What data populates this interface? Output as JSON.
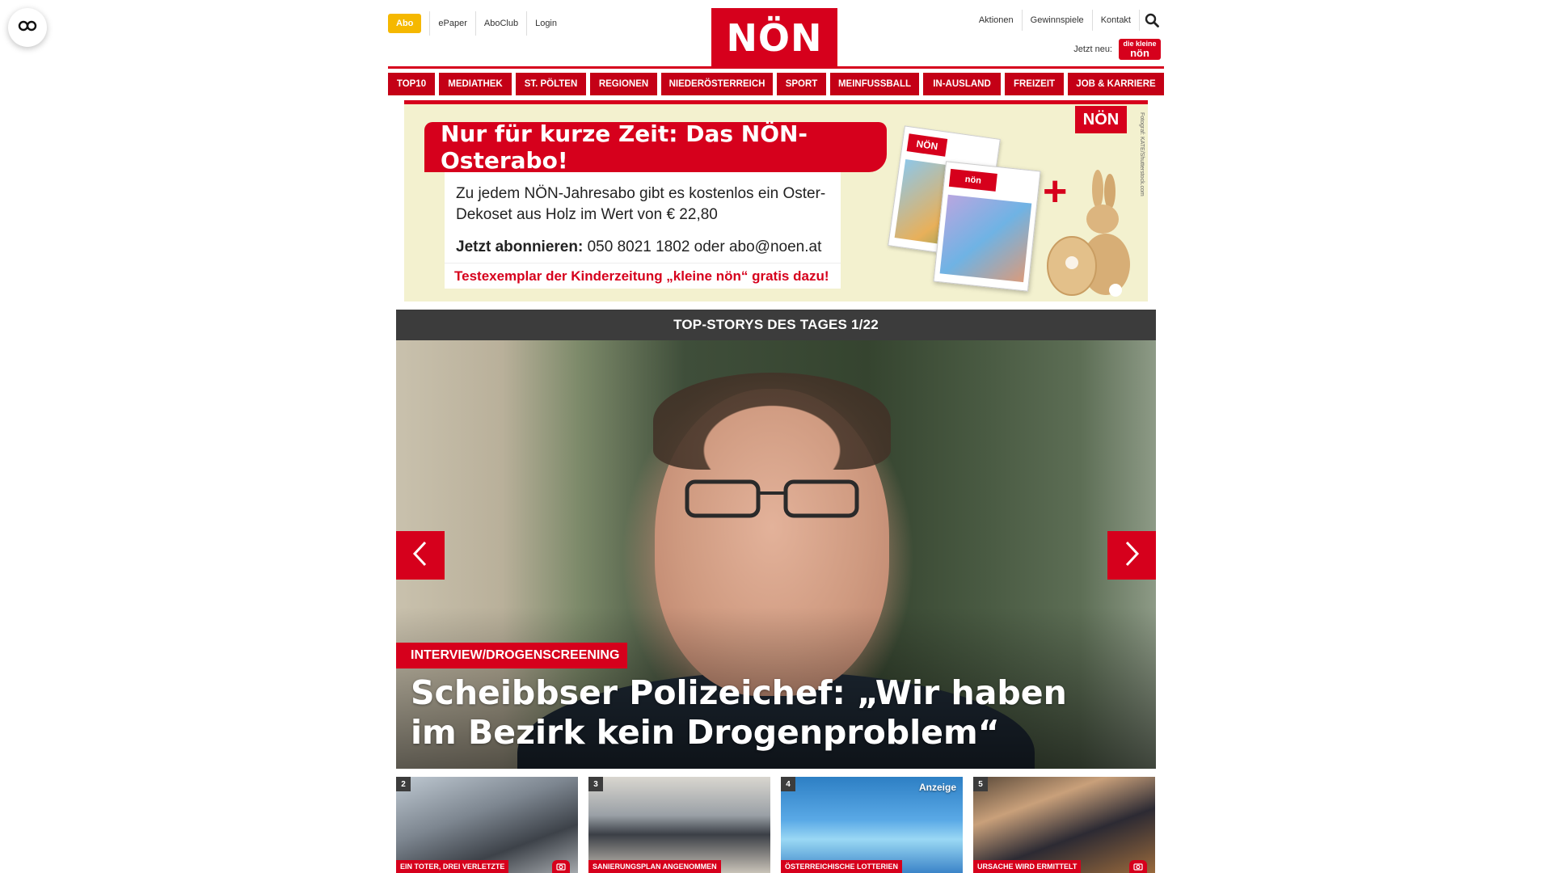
{
  "header": {
    "abo_label": "Abo",
    "left_links": [
      "ePaper",
      "AboClub",
      "Login"
    ],
    "logo_text": "NÖN",
    "right_links": [
      "Aktionen",
      "Gewinnspiele",
      "Kontakt"
    ],
    "jetzt_label": "Jetzt neu:",
    "kleine_badge_line1": "die kleine",
    "kleine_badge_line2": "nön"
  },
  "nav": {
    "items": [
      "TOP10",
      "MEDIATHEK",
      "ST. PÖLTEN",
      "REGIONEN",
      "NIEDERÖSTERREICH",
      "SPORT",
      "MEINFUSSBALL",
      "IN-AUSLAND",
      "FREIZEIT",
      "JOB & KARRIERE"
    ]
  },
  "ad": {
    "title": "Nur für kurze Zeit: Das NÖN-Osterabo!",
    "body_line1": "Zu jedem NÖN-Jahresabo gibt es kostenlos ein Oster-Dekoset aus Holz im Wert von € 22,80",
    "body_cta_bold": "Jetzt abonnieren:",
    "body_cta_rest": " 050 8021 1802 oder abo@noen.at",
    "strip": "Testexemplar der Kinderzeitung „kleine nön“ gratis dazu!",
    "logo_text": "NÖN",
    "paper_mast": "NÖN",
    "credit": "Fotograf: KATE/Shutterstock.com",
    "plus": "+"
  },
  "slider": {
    "heading": "TOP-STORYS DES TAGES 1/22",
    "tag": "INTERVIEW/DROGENSCREENING",
    "title": "Scheibbser Polizeichef: „Wir haben im Bezirk kein Drogenproblem“"
  },
  "thumbs": [
    {
      "num": "2",
      "category": "EIN TOTER, DREI VERLETZTE",
      "camera": true,
      "sponsored": ""
    },
    {
      "num": "3",
      "category": "SANIERUNGSPLAN ANGENOMMEN",
      "camera": false,
      "sponsored": ""
    },
    {
      "num": "4",
      "category": "ÖSTERREICHISCHE LOTTERIEN",
      "camera": false,
      "sponsored": "Anzeige"
    },
    {
      "num": "5",
      "category": "URSACHE WIRD ERMITTELT",
      "camera": true,
      "sponsored": ""
    }
  ],
  "colors": {
    "brand_red": "#d6001c",
    "abo_yellow": "#f5b800",
    "slider_head": "#3c3c3c",
    "ad_background": "#f3f1cf"
  }
}
